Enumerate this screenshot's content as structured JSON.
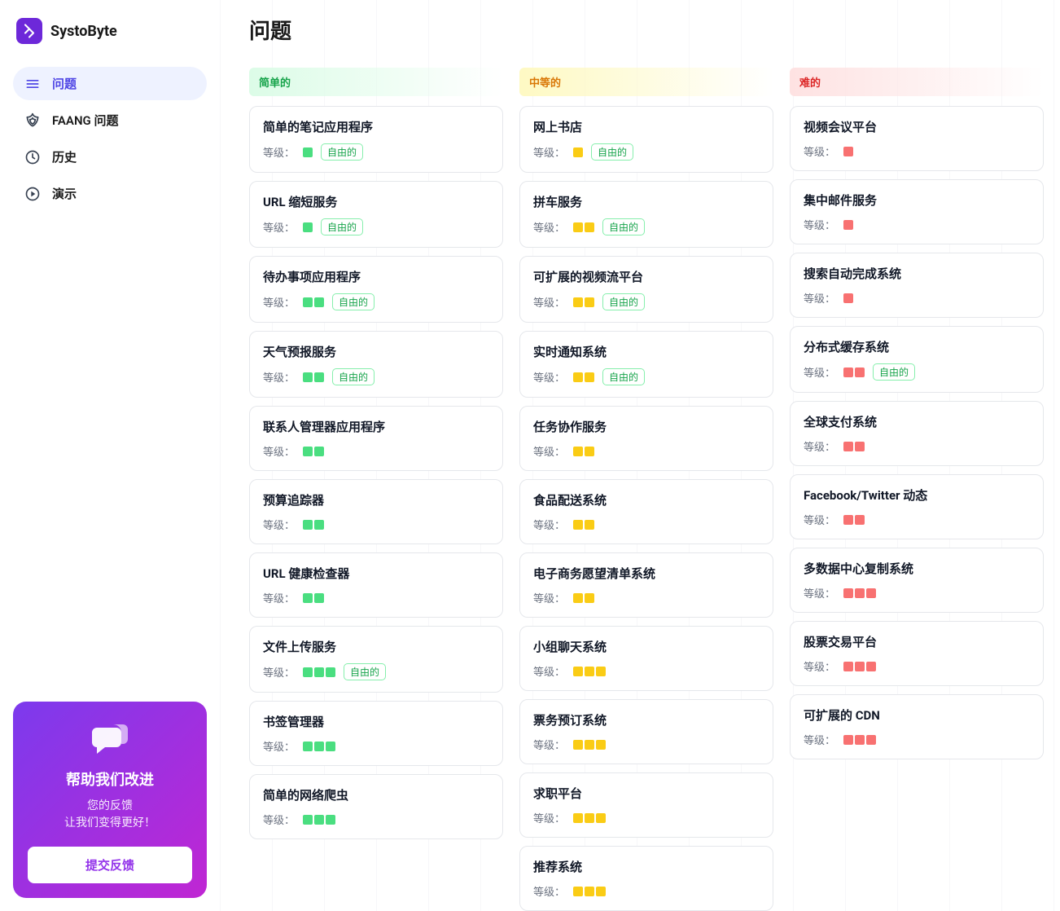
{
  "brand": "SystoByte",
  "pageTitle": "问题",
  "nav": [
    {
      "label": "问题",
      "active": true
    },
    {
      "label": "FAANG 问题",
      "active": false
    },
    {
      "label": "历史",
      "active": false
    },
    {
      "label": "演示",
      "active": false
    }
  ],
  "feedback": {
    "title": "帮助我们改进",
    "line1": "您的反馈",
    "line2": "让我们变得更好！",
    "button": "提交反馈"
  },
  "labels": {
    "level": "等级：",
    "free": "自由的"
  },
  "columns": [
    {
      "name": "简单的",
      "difficulty": "easy",
      "items": [
        {
          "title": "简单的笔记应用程序",
          "level": 1,
          "free": true
        },
        {
          "title": "URL 缩短服务",
          "level": 1,
          "free": true
        },
        {
          "title": "待办事项应用程序",
          "level": 2,
          "free": true
        },
        {
          "title": "天气预报服务",
          "level": 2,
          "free": true
        },
        {
          "title": "联系人管理器应用程序",
          "level": 2,
          "free": false
        },
        {
          "title": "预算追踪器",
          "level": 2,
          "free": false
        },
        {
          "title": "URL 健康检查器",
          "level": 2,
          "free": false
        },
        {
          "title": "文件上传服务",
          "level": 3,
          "free": true
        },
        {
          "title": "书签管理器",
          "level": 3,
          "free": false
        },
        {
          "title": "简单的网络爬虫",
          "level": 3,
          "free": false
        }
      ]
    },
    {
      "name": "中等的",
      "difficulty": "medium",
      "items": [
        {
          "title": "网上书店",
          "level": 1,
          "free": true
        },
        {
          "title": "拼车服务",
          "level": 2,
          "free": true
        },
        {
          "title": "可扩展的视频流平台",
          "level": 2,
          "free": true
        },
        {
          "title": "实时通知系统",
          "level": 2,
          "free": true
        },
        {
          "title": "任务协作服务",
          "level": 2,
          "free": false
        },
        {
          "title": "食品配送系统",
          "level": 2,
          "free": false
        },
        {
          "title": "电子商务愿望清单系统",
          "level": 2,
          "free": false
        },
        {
          "title": "小组聊天系统",
          "level": 3,
          "free": false
        },
        {
          "title": "票务预订系统",
          "level": 3,
          "free": false
        },
        {
          "title": "求职平台",
          "level": 3,
          "free": false
        },
        {
          "title": "推荐系统",
          "level": 3,
          "free": false
        }
      ]
    },
    {
      "name": "难的",
      "difficulty": "hard",
      "items": [
        {
          "title": "视频会议平台",
          "level": 1,
          "free": false
        },
        {
          "title": "集中邮件服务",
          "level": 1,
          "free": false
        },
        {
          "title": "搜索自动完成系统",
          "level": 1,
          "free": false
        },
        {
          "title": "分布式缓存系统",
          "level": 2,
          "free": true
        },
        {
          "title": "全球支付系统",
          "level": 2,
          "free": false
        },
        {
          "title": "Facebook/Twitter 动态",
          "level": 2,
          "free": false
        },
        {
          "title": "多数据中心复制系统",
          "level": 3,
          "free": false
        },
        {
          "title": "股票交易平台",
          "level": 3,
          "free": false
        },
        {
          "title": "可扩展的 CDN",
          "level": 3,
          "free": false
        }
      ]
    }
  ]
}
